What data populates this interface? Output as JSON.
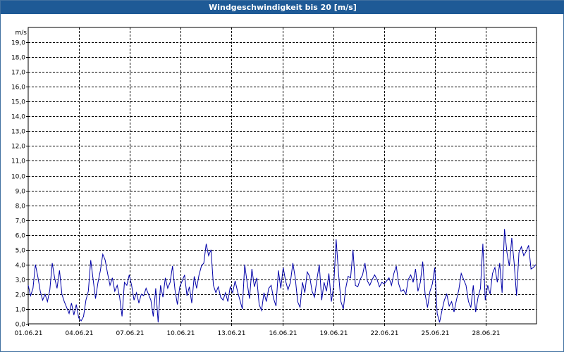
{
  "window": {
    "title": "Windgeschwindigkeit bis 20 [m/s]"
  },
  "colors": {
    "titlebar": "#1e5a96",
    "line": "#0000a8",
    "grid": "#000000"
  },
  "chart_data": {
    "type": "line",
    "title": "Windgeschwindigkeit bis 20 [m/s]",
    "ylabel": "m/s",
    "xlabel": "",
    "ylim": [
      0,
      20
    ],
    "xlim": [
      "01.06.21",
      "01.07.21"
    ],
    "grid": true,
    "x_ticks": [
      "01.06.21",
      "04.06.21",
      "07.06.21",
      "10.06.21",
      "13.06.21",
      "16.06.21",
      "19.06.21",
      "22.06.21",
      "25.06.21",
      "28.06.21"
    ],
    "y_ticks": [
      "0,0",
      "1,0",
      "2,0",
      "3,0",
      "4,0",
      "5,0",
      "6,0",
      "7,0",
      "8,0",
      "9,0",
      "10,0",
      "11,0",
      "12,0",
      "13,0",
      "14,0",
      "15,0",
      "16,0",
      "17,0",
      "18,0",
      "19,0"
    ],
    "series": [
      {
        "x_start": "01.06.21",
        "step_hours": 3,
        "values": [
          2.6,
          1.9,
          2.4,
          4.0,
          3.2,
          2.2,
          1.6,
          2.0,
          1.5,
          2.3,
          4.1,
          3.1,
          2.4,
          3.6,
          2.0,
          1.5,
          1.1,
          0.7,
          1.4,
          0.6,
          1.3,
          0.4,
          0.2,
          0.5,
          1.6,
          2.2,
          4.3,
          3.0,
          1.7,
          2.8,
          3.6,
          4.7,
          4.3,
          3.4,
          2.6,
          3.1,
          2.2,
          2.6,
          1.8,
          0.5,
          2.8,
          2.6,
          3.3,
          2.6,
          1.6,
          2.1,
          1.4,
          2.0,
          1.9,
          2.4,
          2.0,
          1.6,
          0.5,
          2.4,
          0.1,
          2.6,
          1.8,
          3.1,
          2.4,
          2.8,
          3.9,
          2.3,
          1.3,
          2.5,
          2.9,
          3.3,
          1.9,
          2.5,
          1.4,
          3.2,
          2.4,
          3.3,
          3.9,
          4.1,
          5.4,
          4.6,
          5.0,
          2.6,
          2.1,
          2.5,
          1.8,
          1.6,
          2.1,
          1.5,
          2.5,
          2.1,
          2.9,
          2.2,
          1.6,
          1.0,
          4.0,
          2.8,
          1.7,
          3.7,
          2.5,
          3.1,
          1.3,
          0.9,
          2.1,
          1.5,
          2.4,
          2.6,
          1.7,
          1.2,
          3.6,
          2.4,
          3.8,
          2.9,
          2.3,
          2.8,
          4.1,
          3.1,
          1.5,
          1.1,
          2.8,
          2.1,
          3.5,
          3.2,
          2.2,
          1.8,
          3.0,
          4.0,
          1.6,
          2.8,
          2.2,
          3.4,
          1.5,
          2.6,
          5.7,
          3.4,
          1.5,
          1.0,
          2.4,
          3.2,
          3.1,
          5.0,
          2.6,
          2.5,
          3.0,
          3.3,
          4.1,
          2.9,
          2.6,
          3.0,
          3.3,
          3.0,
          2.5,
          2.8,
          2.7,
          2.9,
          3.1,
          2.6,
          3.4,
          3.9,
          2.7,
          2.2,
          2.3,
          2.0,
          3.0,
          3.3,
          2.8,
          3.7,
          2.2,
          2.8,
          4.2,
          2.0,
          1.1,
          2.2,
          2.7,
          3.8,
          0.7,
          0.1,
          0.9,
          1.6,
          2.0,
          1.2,
          1.5,
          0.8,
          1.6,
          2.3,
          3.4,
          3.0,
          2.6,
          1.5,
          1.1,
          2.6,
          0.8,
          1.8,
          2.4,
          5.4,
          1.6,
          2.6,
          2.0,
          3.4,
          3.8,
          2.8,
          4.1,
          2.1,
          6.4,
          4.8,
          3.9,
          5.8,
          4.1,
          1.9,
          4.8,
          5.2,
          4.6,
          4.9,
          5.3,
          3.7,
          3.8,
          4.0
        ]
      }
    ]
  }
}
